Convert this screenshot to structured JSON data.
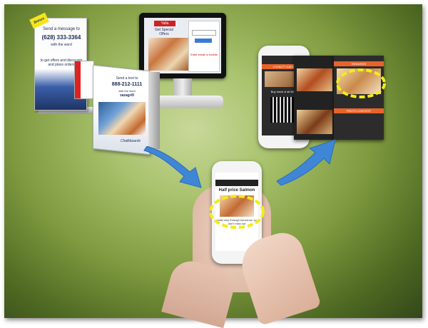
{
  "acrylic_stand": {
    "badge": "Bonus",
    "headline": "Send a message to",
    "phone_number": "(628) 333-3364",
    "with_word": "with the word",
    "offer_text": "to get offers and discounts and place orders"
  },
  "tent_card": {
    "headline": "Send a text to",
    "phone_number": "888-212-1111",
    "with_word": "with the word",
    "keyword": "zazagrill",
    "brand": "Chalkboards"
  },
  "kiosk": {
    "brand": "Yalla",
    "heading": "Get Special Offers",
    "prompt": "Enter email or mobile"
  },
  "center_phone": {
    "headline": "Half price Salmon",
    "subline": "Valid only through tomorrow, so don't miss out"
  },
  "app_screens": {
    "left_bar": "LOYALTY CARD",
    "left_caption": "Buy lunch & sit 5th...",
    "right_bar": "PHOTO CONTEST",
    "top_bar": "REWARDS"
  },
  "colors": {
    "accent": "#e8632a",
    "highlight": "#f2ec1c",
    "arrow": "#3f86d6"
  },
  "icons": [
    "arrow-right-icon",
    "arrow-up-right-icon",
    "highlight-ellipse-icon"
  ]
}
